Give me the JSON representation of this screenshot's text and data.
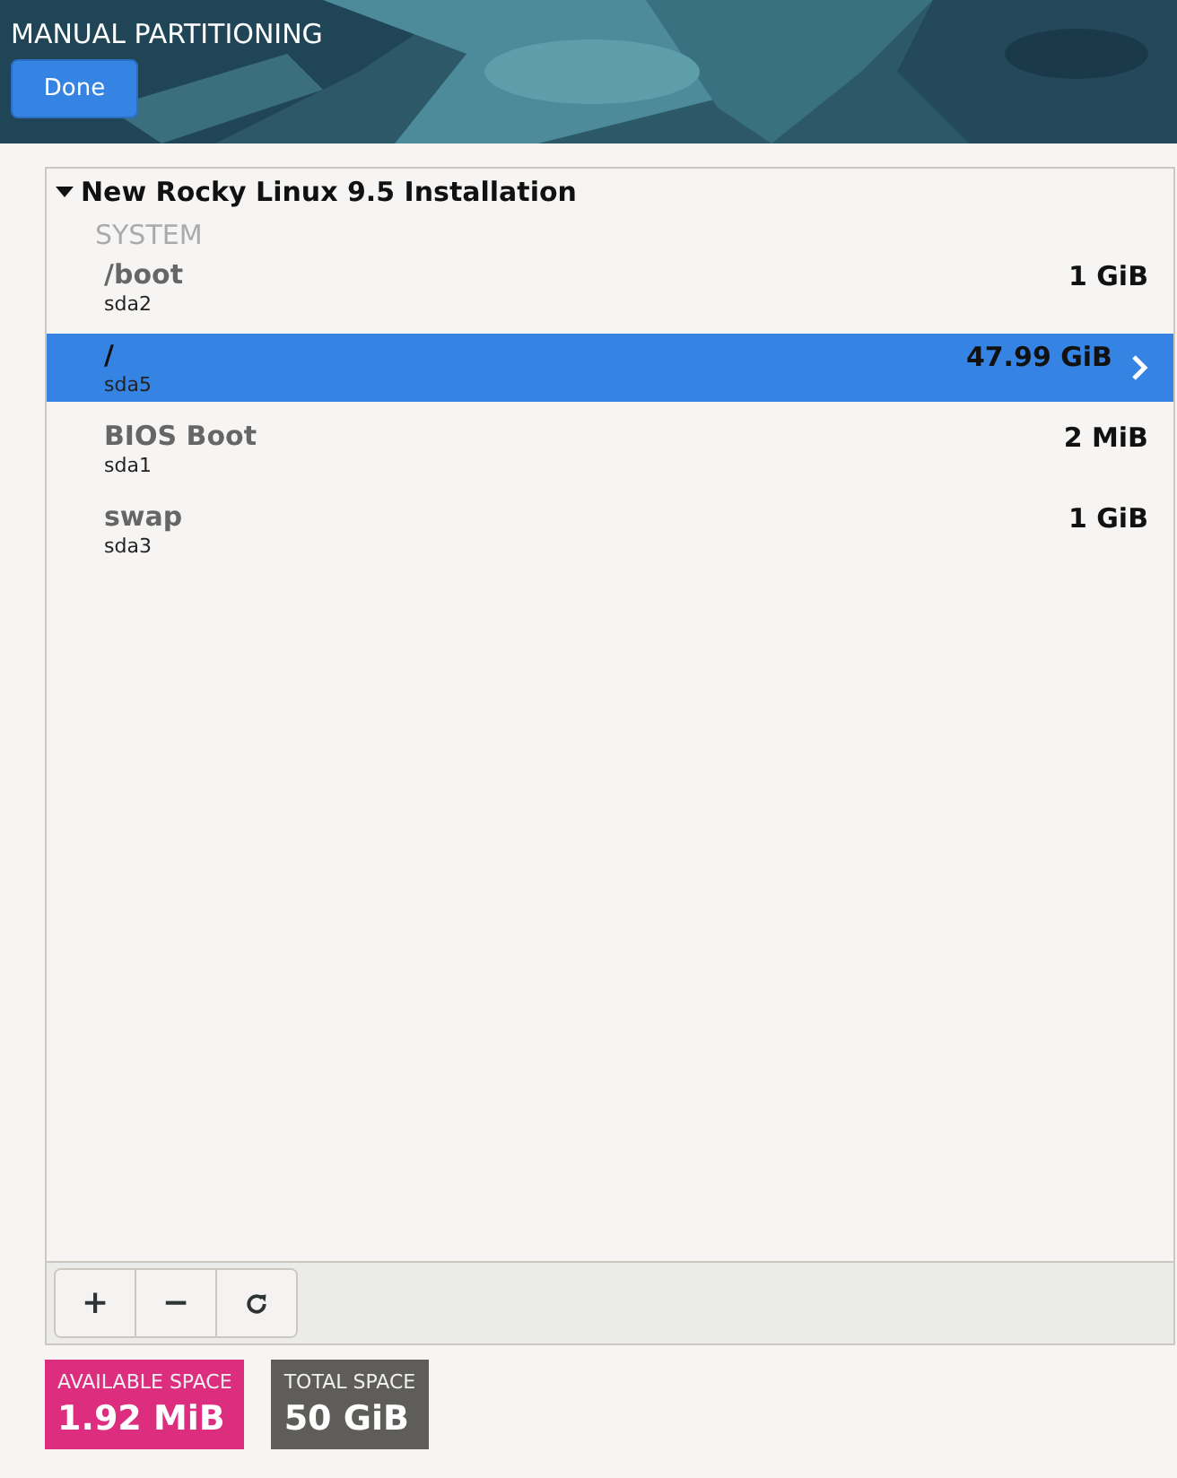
{
  "header": {
    "title": "MANUAL PARTITIONING",
    "done_button": "Done"
  },
  "installation": {
    "title": "New Rocky Linux 9.5 Installation",
    "expanded": true,
    "section": "SYSTEM",
    "partitions": [
      {
        "mount": "/boot",
        "device": "sda2",
        "size": "1 GiB",
        "selected": false
      },
      {
        "mount": "/",
        "device": "sda5",
        "size": "47.99 GiB",
        "selected": true
      },
      {
        "mount": "BIOS Boot",
        "device": "sda1",
        "size": "2 MiB",
        "selected": false
      },
      {
        "mount": "swap",
        "device": "sda3",
        "size": "1 GiB",
        "selected": false
      }
    ]
  },
  "toolbar": {
    "add": "+",
    "remove": "−"
  },
  "space": [
    {
      "label": "AVAILABLE SPACE",
      "value": "1.92 MiB",
      "color": "#dd2d7e"
    },
    {
      "label": "TOTAL SPACE",
      "value": "50 GiB",
      "color": "#5e5d59"
    }
  ]
}
